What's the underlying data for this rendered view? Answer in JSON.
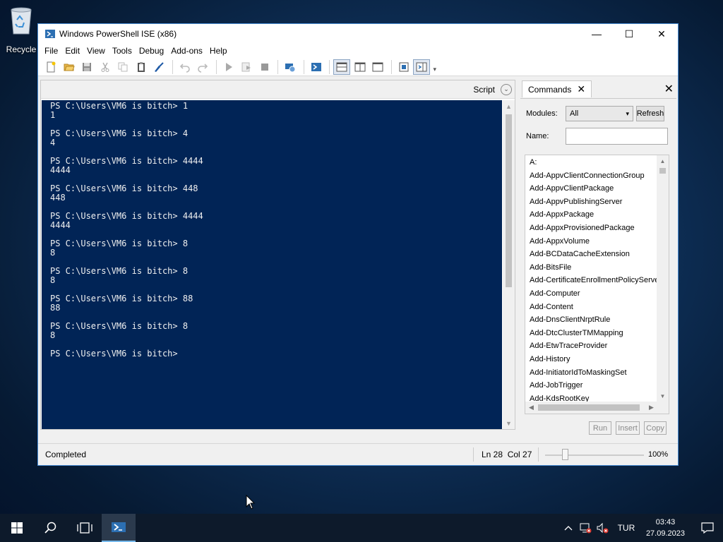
{
  "desktop": {
    "recycle_label": "Recycle"
  },
  "window": {
    "title": "Windows PowerShell ISE (x86)",
    "controls": {
      "minimize": "—",
      "maximize": "☐",
      "close": "✕"
    }
  },
  "menu": [
    "File",
    "Edit",
    "View",
    "Tools",
    "Debug",
    "Add-ons",
    "Help"
  ],
  "script_bar": {
    "label": "Script"
  },
  "console": {
    "prompt": "PS C:\\Users\\VM6 is bitch> ",
    "entries": [
      {
        "input": "1",
        "output": "1"
      },
      {
        "input": "4",
        "output": "4"
      },
      {
        "input": "4444",
        "output": "4444"
      },
      {
        "input": "448",
        "output": "448"
      },
      {
        "input": "4444",
        "output": "4444"
      },
      {
        "input": "8",
        "output": "8"
      },
      {
        "input": "8",
        "output": "8"
      },
      {
        "input": "88",
        "output": "88"
      },
      {
        "input": "8",
        "output": "8"
      }
    ],
    "last_prompt": "PS C:\\Users\\VM6 is bitch>"
  },
  "commands": {
    "tab_label": "Commands",
    "modules_label": "Modules:",
    "modules_value": "All",
    "refresh_label": "Refresh",
    "name_label": "Name:",
    "list": [
      "A:",
      "Add-AppvClientConnectionGroup",
      "Add-AppvClientPackage",
      "Add-AppvPublishingServer",
      "Add-AppxPackage",
      "Add-AppxProvisionedPackage",
      "Add-AppxVolume",
      "Add-BCDataCacheExtension",
      "Add-BitsFile",
      "Add-CertificateEnrollmentPolicyServe",
      "Add-Computer",
      "Add-Content",
      "Add-DnsClientNrptRule",
      "Add-DtcClusterTMMapping",
      "Add-EtwTraceProvider",
      "Add-History",
      "Add-InitiatorIdToMaskingSet",
      "Add-JobTrigger",
      "Add-KdsRootKey"
    ],
    "run_label": "Run",
    "insert_label": "Insert",
    "copy_label": "Copy"
  },
  "status": {
    "text": "Completed",
    "position": "Ln 28  Col 27",
    "zoom": "100%"
  },
  "taskbar": {
    "language": "TUR",
    "time": "03:43",
    "date": "27.09.2023"
  },
  "colors": {
    "console_bg": "#012456",
    "accent": "#4a8ed6"
  }
}
